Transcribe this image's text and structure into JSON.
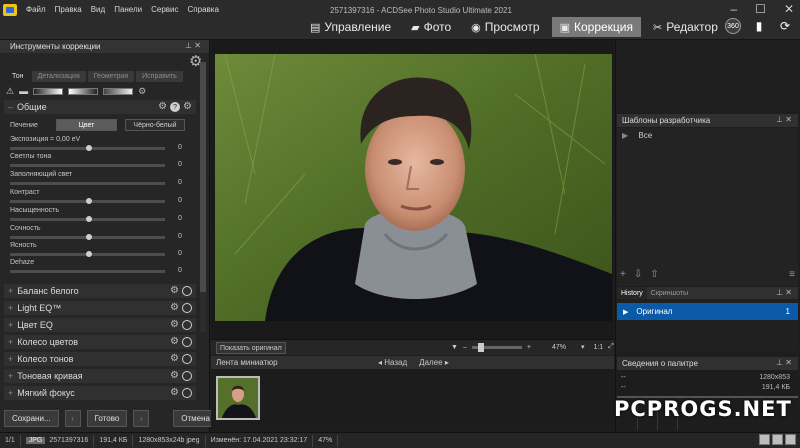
{
  "titlebar": {
    "menu": [
      "Файл",
      "Правка",
      "Вид",
      "Панели",
      "Сервис",
      "Справка"
    ],
    "document_title": "2571397316 - ACDSee Photo Studio Ultimate 2021",
    "modes": [
      {
        "icon": "folder-icon",
        "label": "Управление"
      },
      {
        "icon": "photo-icon",
        "label": "Фото"
      },
      {
        "icon": "eye-icon",
        "label": "Просмотр"
      },
      {
        "icon": "develop-icon",
        "label": "Коррекция"
      },
      {
        "icon": "edit-icon",
        "label": "Редактор"
      }
    ],
    "active_mode": "Коррекция",
    "badge_360": "360"
  },
  "left_panel": {
    "title": "Инструменты коррекции",
    "tabs": [
      "Тон",
      "Детализация",
      "Геометрия",
      "Исправить"
    ],
    "general": {
      "title": "Общие",
      "treatment_label": "Печение",
      "color_label": "Цвет",
      "bw_label": "Чёрно-белый",
      "exposure_label": "Экспозиция = 0,00 eV",
      "sliders": [
        {
          "label": "Светлы тона",
          "value": "0"
        },
        {
          "label": "Заполняющий свет",
          "value": "0"
        },
        {
          "label": "Контраст",
          "value": "0"
        },
        {
          "label": "Насыщенность",
          "value": "0"
        },
        {
          "label": "Сочность",
          "value": "0"
        },
        {
          "label": "Ясность",
          "value": "0"
        },
        {
          "label": "Dehaze",
          "value": "0"
        }
      ],
      "exposure_value": "0"
    },
    "sections": [
      "Баланс белого",
      "Light EQ™",
      "Цвет EQ",
      "Колесо цветов",
      "Колесо тонов",
      "Тоновая кривая",
      "Мягкий фокус"
    ],
    "buttons": {
      "save": "Сохрани...",
      "done": "Готово",
      "cancel": "Отмена"
    }
  },
  "viewer": {
    "show_original": "Показать оригинал",
    "zoom": "47%",
    "fit_label": "1:1"
  },
  "filmstrip": {
    "title": "Лента миниатюр",
    "back": "Назад",
    "next": "Далее"
  },
  "right_panel": {
    "templates_title": "Шаблоны разработчика",
    "templates_root": "Все",
    "history_tabs": [
      "History",
      "Скриншоты"
    ],
    "history_entry": "Оригинал",
    "history_index": "1",
    "info_title": "Сведения о палитре",
    "info_dims": "1280x853",
    "info_size": "191,4 КБ",
    "dashes": "--"
  },
  "statusbar": {
    "index": "1/1",
    "format": "JPG",
    "name": "2571397316",
    "size": "191,4 КБ",
    "dims": "1280x853x24b jpeg",
    "modified": "Изменён: 17.04.2021 23:32:17",
    "zoom": "47%"
  },
  "watermark": "PCPROGS.NET",
  "colors": {
    "accent": "#0b5aa8",
    "active_mode": "#7a7a7a"
  }
}
